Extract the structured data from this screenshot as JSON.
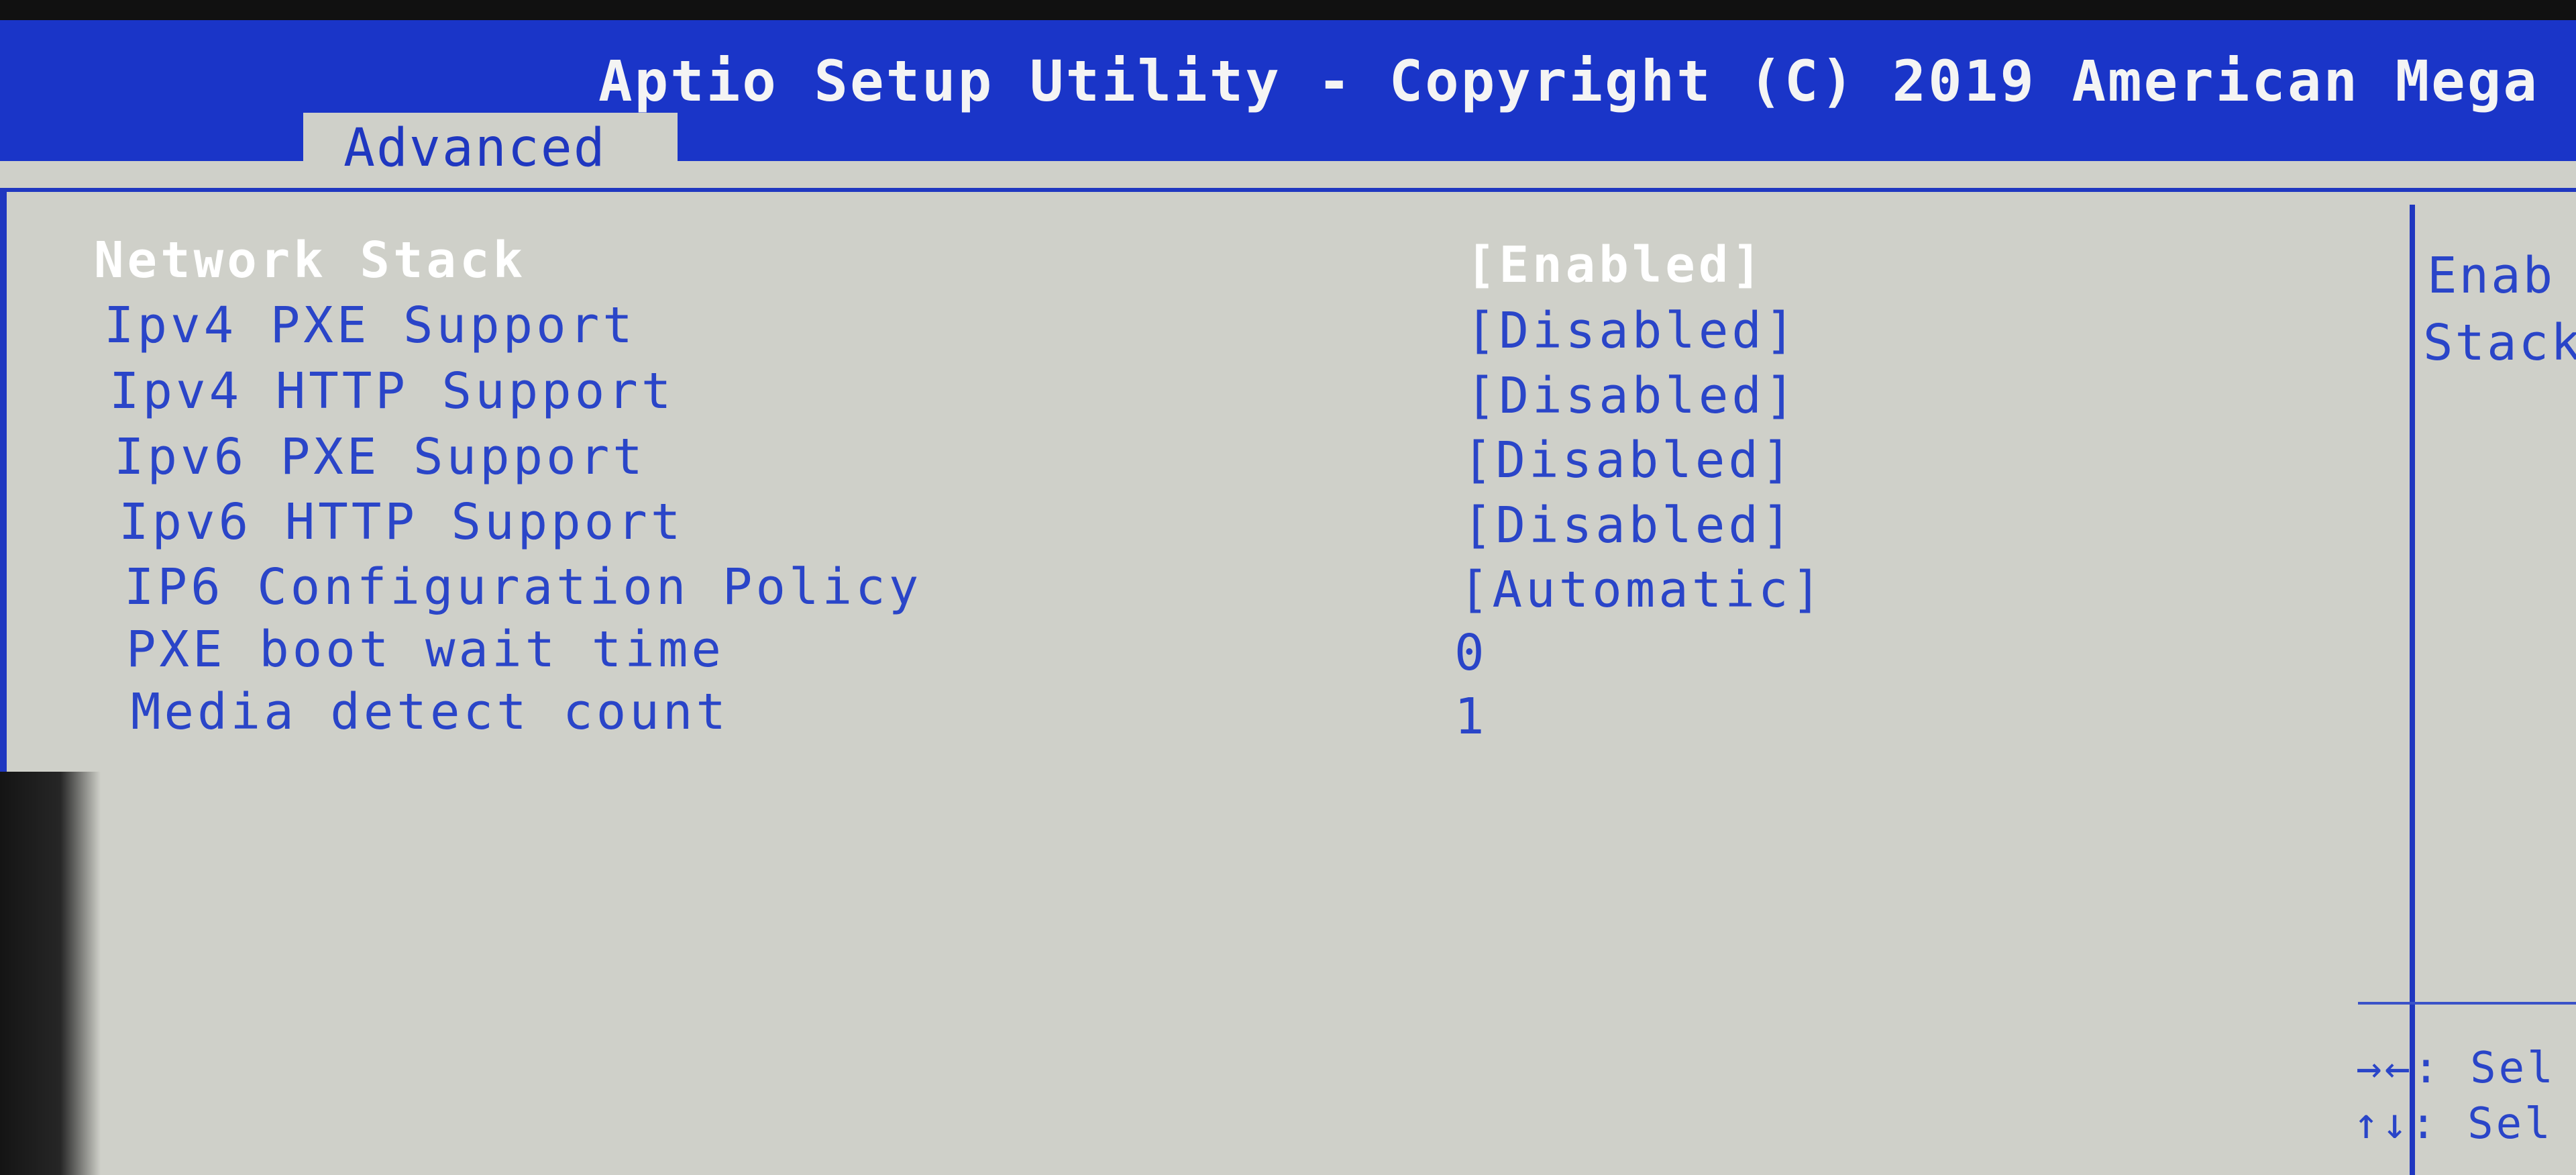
{
  "header": {
    "title": "Aptio Setup Utility - Copyright (C) 2019 American Mega",
    "tab": "Advanced"
  },
  "settings": [
    {
      "label": "Network Stack",
      "value": "[Enabled]",
      "selected": true
    },
    {
      "label": "Ipv4 PXE Support",
      "value": "[Disabled]"
    },
    {
      "label": "Ipv4 HTTP Support",
      "value": "[Disabled]"
    },
    {
      "label": "Ipv6 PXE Support",
      "value": "[Disabled]"
    },
    {
      "label": "Ipv6 HTTP Support",
      "value": "[Disabled]"
    },
    {
      "label": "IP6 Configuration Policy",
      "value": "[Automatic]"
    },
    {
      "label": "PXE boot wait time",
      "value": "0"
    },
    {
      "label": "Media detect count",
      "value": "1"
    }
  ],
  "help": {
    "line1": "Enab",
    "line2": "Stack"
  },
  "key_hints": [
    {
      "keys": "→←: ",
      "text": "Sel"
    },
    {
      "keys": "↑↓: ",
      "text": "Sel"
    }
  ],
  "colors": {
    "header_blue": "#1a35c8",
    "panel_bg": "#cfd0c9",
    "text_blue": "#2a45c8",
    "selected_text": "#ffffff"
  }
}
